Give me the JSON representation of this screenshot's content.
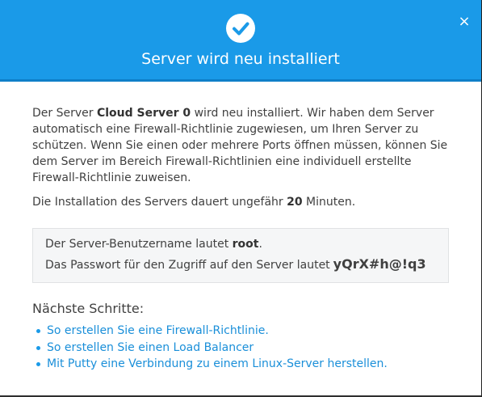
{
  "dialog": {
    "title": "Server wird neu installiert",
    "close_label": "×",
    "accent_color": "#1a9ae8"
  },
  "body": {
    "p1_a": "Der Server ",
    "server_name": "Cloud Server 0",
    "p1_b": " wird neu installiert. Wir haben dem Server automatisch eine Firewall-Richtlinie zugewiesen, um Ihren Server zu schützen. Wenn Sie einen oder mehrere Ports öffnen müssen, können Sie dem Server im Bereich Firewall-Richtlinien eine individuell erstellte Firewall-Richtlinie zuweisen.",
    "p2_a": "Die Installation des Servers dauert ungefähr ",
    "duration": "20",
    "p2_b": " Minuten."
  },
  "credentials": {
    "user_prefix": "Der Server-Benutzername lautet ",
    "username": "root",
    "user_suffix": ".",
    "pw_prefix": "Das Passwort für den Zugriff auf den Server lautet",
    "password": "yQrX#h@!q3"
  },
  "next_steps": {
    "title": "Nächste Schritte:",
    "links": [
      "So erstellen Sie eine Firewall-Richtlinie.",
      "So erstellen Sie einen Load Balancer",
      "Mit Putty eine Verbindung zu einem Linux-Server herstellen."
    ]
  }
}
